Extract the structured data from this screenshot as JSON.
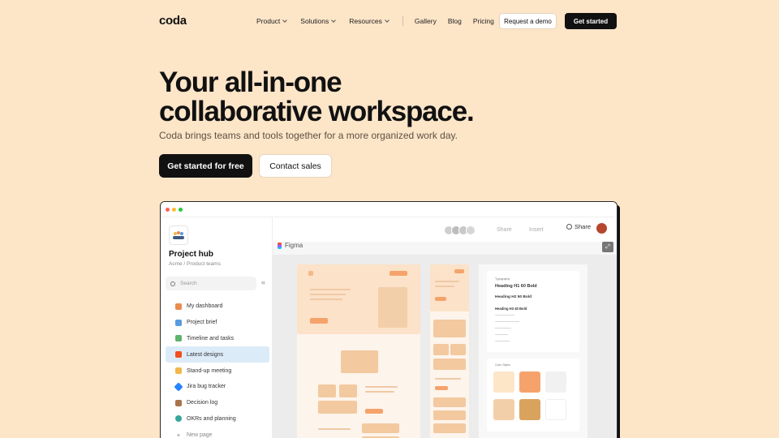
{
  "nav": {
    "logo": "coda",
    "dropdowns": [
      "Product",
      "Solutions",
      "Resources"
    ],
    "links": [
      "Gallery",
      "Blog",
      "Pricing"
    ],
    "request_demo": "Request a demo",
    "get_started": "Get started"
  },
  "hero": {
    "title_line1": "Your all-in-one",
    "title_line2": "collaborative workspace.",
    "subtitle": "Coda brings teams and tools together for a more organized work day.",
    "cta_primary": "Get started for free",
    "cta_secondary": "Contact sales"
  },
  "app": {
    "window_dots": [
      "#ff5f57",
      "#febc2e",
      "#28c840"
    ],
    "sidebar": {
      "doc_title": "Project hub",
      "doc_breadcrumb": "Acme / Product teams",
      "search_placeholder": "Search",
      "collapse_glyph": "«",
      "items": [
        {
          "label": "My dashboard",
          "icon": "house-icon",
          "color": "#e98b4f"
        },
        {
          "label": "Project brief",
          "icon": "folder-icon",
          "color": "#5a9be0"
        },
        {
          "label": "Timeline and tasks",
          "icon": "clipboard-icon",
          "color": "#5fb36a"
        },
        {
          "label": "Latest designs",
          "icon": "figma-icon",
          "color": "#f24e1e"
        },
        {
          "label": "Stand-up meeting",
          "icon": "people-icon",
          "color": "#f2b84b"
        },
        {
          "label": "Jira bug tracker",
          "icon": "jira-icon",
          "color": "#2684ff"
        },
        {
          "label": "Decision log",
          "icon": "gavel-icon",
          "color": "#a9744b"
        },
        {
          "label": "OKRs and planning",
          "icon": "target-icon",
          "color": "#37a69c"
        }
      ],
      "new_page": "New page"
    },
    "toolbar": {
      "share_ghost": "Share",
      "insert_ghost": "Insert",
      "share": "Share"
    },
    "embed_label": "Figma",
    "styleguide": {
      "caption": "Typography",
      "h1": "Heading H1 60 Bold",
      "h2": "Heading H2 50 Bold",
      "h3": "Heading H3 40 Bold",
      "colors_caption": "Color Styles"
    }
  }
}
